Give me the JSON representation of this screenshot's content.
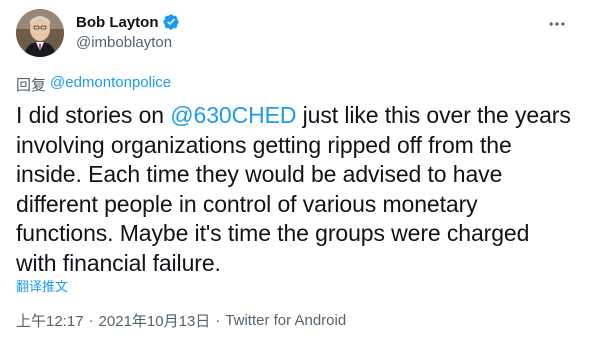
{
  "author": {
    "display_name": "Bob Layton",
    "handle": "@imboblayton",
    "verified": true,
    "avatar": "profile-photo"
  },
  "reply": {
    "prefix": "回复",
    "to": "@edmontonpolice"
  },
  "body": {
    "before_mention": "I did stories on ",
    "mention": "@630CHED",
    "after_mention": " just like this over the years involving organizations getting ripped off from the inside. Each time they would be advised to have different people in control of various monetary functions.  Maybe it's time the groups were charged with financial failure."
  },
  "translate_label": "翻译推文",
  "meta": {
    "time": "上午12:17",
    "separator": "·",
    "date": "2021年10月13日",
    "source": "Twitter for Android"
  },
  "colors": {
    "accent": "#1d9bf0",
    "text": "#0f1419",
    "secondary": "#536471"
  },
  "icons": {
    "verified": "verified-badge-icon",
    "more": "more-options-icon"
  }
}
